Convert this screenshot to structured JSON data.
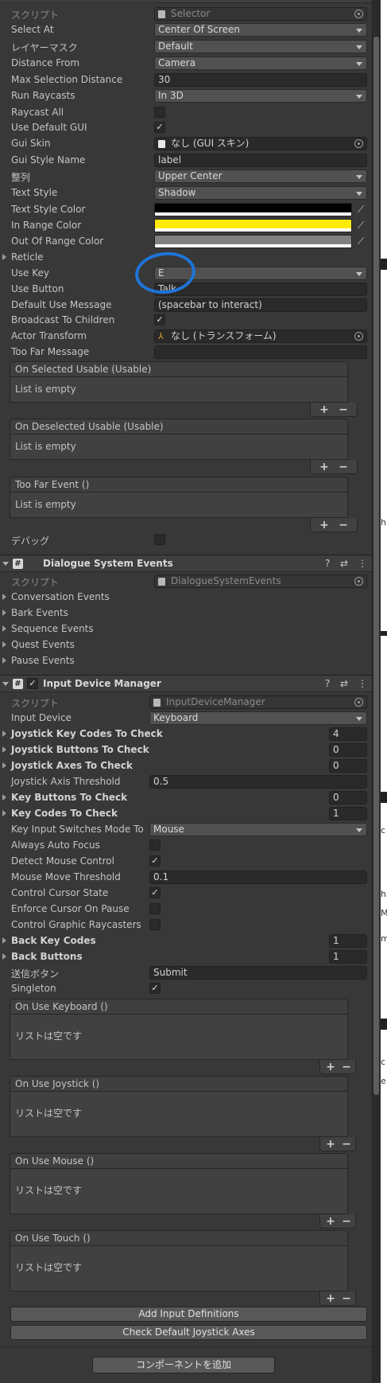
{
  "selector": {
    "script_label": "スクリプト",
    "script_value": "Selector",
    "select_at": {
      "label": "Select At",
      "value": "Center Of Screen"
    },
    "layer_mask": {
      "label": "レイヤーマスク",
      "value": "Default"
    },
    "distance_from": {
      "label": "Distance From",
      "value": "Camera"
    },
    "max_selection_distance": {
      "label": "Max Selection Distance",
      "value": "30"
    },
    "run_raycasts": {
      "label": "Run Raycasts",
      "value": "In 3D"
    },
    "raycast_all": {
      "label": "Raycast All",
      "checked": false
    },
    "use_default_gui": {
      "label": "Use Default GUI",
      "checked": true
    },
    "gui_skin": {
      "label": "Gui Skin",
      "value": "なし (GUI スキン)"
    },
    "gui_style_name": {
      "label": "Gui Style Name",
      "value": "label"
    },
    "alignment": {
      "label": "整列",
      "value": "Upper Center"
    },
    "text_style": {
      "label": "Text Style",
      "value": "Shadow"
    },
    "text_style_color": {
      "label": "Text Style Color",
      "color": "#000000"
    },
    "in_range_color": {
      "label": "In Range Color",
      "color": "#ffeb04"
    },
    "out_of_range_color": {
      "label": "Out Of Range Color",
      "color": "#808080"
    },
    "reticle": {
      "label": "Reticle"
    },
    "use_key": {
      "label": "Use Key",
      "value": "E"
    },
    "use_button": {
      "label": "Use Button",
      "value": "Talk"
    },
    "default_use_message": {
      "label": "Default Use Message",
      "value": "(spacebar to interact)"
    },
    "broadcast_to_children": {
      "label": "Broadcast To Children",
      "checked": true
    },
    "actor_transform": {
      "label": "Actor Transform",
      "value": "なし (トランスフォーム)"
    },
    "too_far_message": {
      "label": "Too Far Message",
      "value": ""
    },
    "events": [
      {
        "title": "On Selected Usable (Usable)",
        "empty": "List is empty"
      },
      {
        "title": "On Deselected Usable (Usable)",
        "empty": "List is empty"
      },
      {
        "title": "Too Far Event ()",
        "empty": "List is empty"
      }
    ],
    "debug": {
      "label": "デバッグ",
      "checked": false
    }
  },
  "dialogue_events": {
    "title": "Dialogue System Events",
    "script_label": "スクリプト",
    "script_value": "DialogueSystemEvents",
    "items": [
      "Conversation Events",
      "Bark Events",
      "Sequence Events",
      "Quest Events",
      "Pause Events"
    ]
  },
  "input_manager": {
    "title": "Input Device Manager",
    "script_label": "スクリプト",
    "script_value": "InputDeviceManager",
    "input_device": {
      "label": "Input Device",
      "value": "Keyboard"
    },
    "joystick_key_codes": {
      "label": "Joystick Key Codes To Check",
      "value": "4"
    },
    "joystick_buttons": {
      "label": "Joystick Buttons To Check",
      "value": "0"
    },
    "joystick_axes": {
      "label": "Joystick Axes To Check",
      "value": "0"
    },
    "joystick_axis_threshold": {
      "label": "Joystick Axis Threshold",
      "value": "0.5"
    },
    "key_buttons": {
      "label": "Key Buttons To Check",
      "value": "0"
    },
    "key_codes": {
      "label": "Key Codes To Check",
      "value": "1"
    },
    "key_input_switches": {
      "label": "Key Input Switches Mode To",
      "value": "Mouse"
    },
    "always_auto_focus": {
      "label": "Always Auto Focus",
      "checked": false
    },
    "detect_mouse_control": {
      "label": "Detect Mouse Control",
      "checked": true
    },
    "mouse_move_threshold": {
      "label": "Mouse Move Threshold",
      "value": "0.1"
    },
    "control_cursor_state": {
      "label": "Control Cursor State",
      "checked": true
    },
    "enforce_cursor_on_pause": {
      "label": "Enforce Cursor On Pause",
      "checked": false
    },
    "control_graphic_raycasters": {
      "label": "Control Graphic Raycasters",
      "checked": false
    },
    "back_key_codes": {
      "label": "Back Key Codes",
      "value": "1"
    },
    "back_buttons": {
      "label": "Back Buttons",
      "value": "1"
    },
    "submit_button": {
      "label": "送信ボタン",
      "value": "Submit"
    },
    "singleton": {
      "label": "Singleton",
      "checked": true
    },
    "events": [
      {
        "title": "On Use Keyboard ()",
        "empty": "リストは空です"
      },
      {
        "title": "On Use Joystick ()",
        "empty": "リストは空です"
      },
      {
        "title": "On Use Mouse ()",
        "empty": "リストは空です"
      },
      {
        "title": "On Use Touch ()",
        "empty": "リストは空です"
      }
    ],
    "add_input_definitions": "Add Input Definitions",
    "check_default_joystick_axes": "Check Default Joystick Axes"
  },
  "add_component": "コンポーネントを追加",
  "check_mark": "✓",
  "plus": "+",
  "minus": "−",
  "menu_icon": "⋮",
  "settings_icon": "⇄",
  "help_icon": "?",
  "right_edge": {
    "h1": "h",
    "c1": "c",
    "h2": "h",
    "m1": "M",
    "m2": "m",
    "c2": "c",
    "e1": "e"
  },
  "colors": {
    "panel": "#383838",
    "highlight_circle": "#1e74d8",
    "in_range": "#ffeb04"
  }
}
